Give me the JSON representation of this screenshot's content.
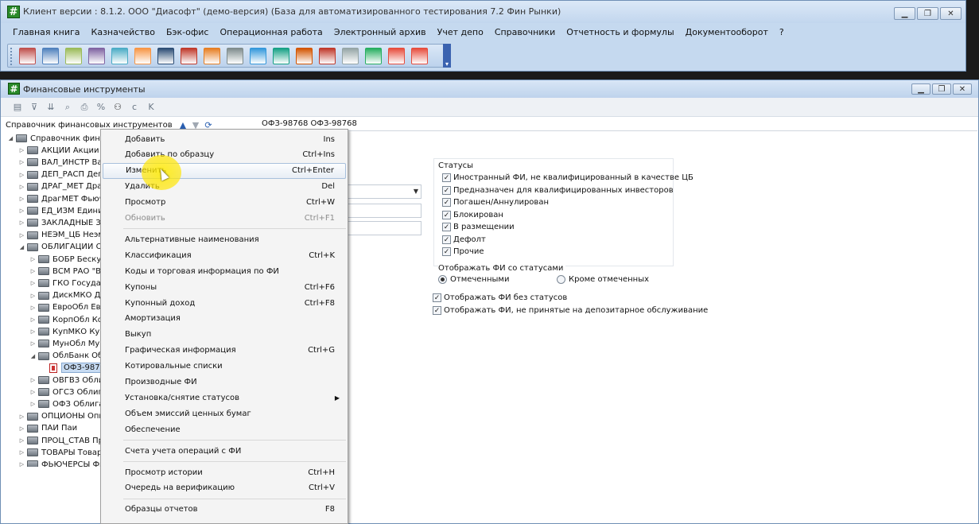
{
  "main_window": {
    "title": "Клиент версии : 8.1.2. ООО \"Диасофт\" (демо-версия) (База для автоматизированного тестирования 7.2 Фин Рынки)",
    "menu": [
      "Главная книга",
      "Казначейство",
      "Бэк-офис",
      "Операционная работа",
      "Электронный архив",
      "Учет депо",
      "Справочники",
      "Отчетность и формулы",
      "Документооборот",
      "?"
    ],
    "window_controls": [
      "minimize",
      "restore",
      "close"
    ]
  },
  "toolbar_icons": [
    "users-icon",
    "document-icon",
    "calculator-icon",
    "clipboard-icon",
    "book-icon",
    "chart-icon",
    "flag-icon",
    "car-icon",
    "fire-icon",
    "register-icon",
    "monitor-icon",
    "bank-icon",
    "exchange-icon",
    "briefcase-icon",
    "notepad-icon",
    "calculator2-icon",
    "archive-icon",
    "stop-icon"
  ],
  "child_window": {
    "title": "Финансовые инструменты",
    "toolbar": [
      "list-icon",
      "filter-icon",
      "sort-icon",
      "search-icon",
      "print-icon",
      "percent-icon",
      "binoculars-icon",
      "c-icon",
      "k-icon"
    ],
    "toolbar_letters": {
      "c": "c",
      "k": "K"
    }
  },
  "left_panel": {
    "header": "Справочник финансовых инструментов",
    "tree": [
      {
        "label": "Справочник финансо",
        "level": 0,
        "exp": "◢",
        "kind": "folder"
      },
      {
        "label": "АКЦИИ Акции",
        "level": 1,
        "exp": "▷",
        "kind": "folder"
      },
      {
        "label": "ВАЛ_ИНСТР Валю",
        "level": 1,
        "exp": "▷",
        "kind": "folder"
      },
      {
        "label": "ДЕП_РАСП Депоз",
        "level": 1,
        "exp": "▷",
        "kind": "folder"
      },
      {
        "label": "ДРАГ_МЕТ Драг",
        "level": 1,
        "exp": "▷",
        "kind": "folder"
      },
      {
        "label": "ДрагМЕТ Фьючер",
        "level": 1,
        "exp": "▷",
        "kind": "folder"
      },
      {
        "label": "ЕД_ИЗМ Единиц",
        "level": 1,
        "exp": "▷",
        "kind": "folder"
      },
      {
        "label": "ЗАКЛАДНЫЕ Закл",
        "level": 1,
        "exp": "▷",
        "kind": "folder"
      },
      {
        "label": "НЕЭМ_ЦБ Неэмис",
        "level": 1,
        "exp": "▷",
        "kind": "folder"
      },
      {
        "label": "ОБЛИГАЦИИ Облиг",
        "level": 1,
        "exp": "◢",
        "kind": "folder"
      },
      {
        "label": "БОБР Бескупо",
        "level": 2,
        "exp": "▷",
        "kind": "folder"
      },
      {
        "label": "ВСМ РАО \"Вы",
        "level": 2,
        "exp": "▷",
        "kind": "folder"
      },
      {
        "label": "ГКО Государ",
        "level": 2,
        "exp": "▷",
        "kind": "folder"
      },
      {
        "label": "ДискМКО Ди",
        "level": 2,
        "exp": "▷",
        "kind": "folder"
      },
      {
        "label": "ЕвроОбл Евр",
        "level": 2,
        "exp": "▷",
        "kind": "folder"
      },
      {
        "label": "КорпОбл Кор",
        "level": 2,
        "exp": "▷",
        "kind": "folder"
      },
      {
        "label": "КупМКО Куп",
        "level": 2,
        "exp": "▷",
        "kind": "folder"
      },
      {
        "label": "МунОбл Мун",
        "level": 2,
        "exp": "▷",
        "kind": "folder"
      },
      {
        "label": "ОблБанк Обл",
        "level": 2,
        "exp": "◢",
        "kind": "folder"
      },
      {
        "label": "ОФЗ-9876",
        "level": 3,
        "exp": "",
        "kind": "doc",
        "selected": true
      },
      {
        "label": "ОВГВЗ Облиг",
        "level": 2,
        "exp": "▷",
        "kind": "folder"
      },
      {
        "label": "ОГСЗ Облига",
        "level": 2,
        "exp": "▷",
        "kind": "folder"
      },
      {
        "label": "ОФЗ Облига",
        "level": 2,
        "exp": "▷",
        "kind": "folder"
      },
      {
        "label": "ОПЦИОНЫ Опцио",
        "level": 1,
        "exp": "▷",
        "kind": "folder"
      },
      {
        "label": "ПАИ Паи",
        "level": 1,
        "exp": "▷",
        "kind": "folder"
      },
      {
        "label": "ПРОЦ_СТАВ Прог",
        "level": 1,
        "exp": "▷",
        "kind": "folder"
      },
      {
        "label": "ТОВАРЫ Товары",
        "level": 1,
        "exp": "▷",
        "kind": "folder"
      },
      {
        "label": "ФЬЮЧЕРСЫ Фью",
        "level": 1,
        "exp": "▷",
        "kind": "folder"
      }
    ]
  },
  "right_panel": {
    "title": "ОФЗ-98768 ОФЗ-98768",
    "statuses_title": "Статусы",
    "statuses": [
      {
        "label": "Иностранный ФИ, не квалифицированный в качестве ЦБ",
        "checked": true
      },
      {
        "label": "Предназначен для квалифицированных инвесторов",
        "checked": true
      },
      {
        "label": "Погашен/Аннулирован",
        "checked": true
      },
      {
        "label": "Блокирован",
        "checked": true
      },
      {
        "label": "В размещении",
        "checked": true
      },
      {
        "label": "Дефолт",
        "checked": true
      },
      {
        "label": "Прочие",
        "checked": true
      }
    ],
    "show_by_status_title": "Отображать ФИ со статусами",
    "radio": [
      {
        "label": "Отмеченными",
        "selected": true
      },
      {
        "label": "Кроме отмеченных",
        "selected": false
      }
    ],
    "extra_checks": [
      {
        "label": "Отображать ФИ без статусов",
        "checked": true
      },
      {
        "label": "Отображать ФИ, не принятые на депозитарное обслуживание",
        "checked": true
      }
    ]
  },
  "context_menu": [
    {
      "label": "Добавить",
      "shortcut": "Ins"
    },
    {
      "label": "Добавить по образцу",
      "shortcut": "Ctrl+Ins"
    },
    {
      "label": "Изменить",
      "shortcut": "Ctrl+Enter",
      "hover": true
    },
    {
      "label": "Удалить",
      "shortcut": "Del"
    },
    {
      "label": "Просмотр",
      "shortcut": "Ctrl+W"
    },
    {
      "label": "Обновить",
      "shortcut": "Ctrl+F1",
      "disabled": true
    },
    {
      "sep": true
    },
    {
      "label": "Альтернативные наименования",
      "shortcut": ""
    },
    {
      "label": "Классификация",
      "shortcut": "Ctrl+K"
    },
    {
      "label": "Коды и торговая информация по ФИ",
      "shortcut": ""
    },
    {
      "label": "Купоны",
      "shortcut": "Ctrl+F6"
    },
    {
      "label": "Купонный доход",
      "shortcut": "Ctrl+F8"
    },
    {
      "label": "Амортизация",
      "shortcut": ""
    },
    {
      "label": "Выкуп",
      "shortcut": ""
    },
    {
      "label": "Графическая информация",
      "shortcut": "Ctrl+G"
    },
    {
      "label": "Котировальные списки",
      "shortcut": ""
    },
    {
      "label": "Производные ФИ",
      "shortcut": ""
    },
    {
      "label": "Установка/снятие статусов",
      "shortcut": "",
      "submenu": true
    },
    {
      "label": "Объем эмиссий ценных бумаг",
      "shortcut": ""
    },
    {
      "label": "Обеспечение",
      "shortcut": ""
    },
    {
      "sep": true
    },
    {
      "label": "Счета учета операций с ФИ",
      "shortcut": ""
    },
    {
      "sep": true
    },
    {
      "label": "Просмотр истории",
      "shortcut": "Ctrl+H"
    },
    {
      "label": "Очередь на верификацию",
      "shortcut": "Ctrl+V"
    },
    {
      "sep": true
    },
    {
      "label": "Образцы отчетов",
      "shortcut": "F8"
    }
  ],
  "colors": {
    "accent": "#2a8a2a",
    "menu_bg": "#f4f4f4",
    "title_bg": "#c5d9ef"
  }
}
